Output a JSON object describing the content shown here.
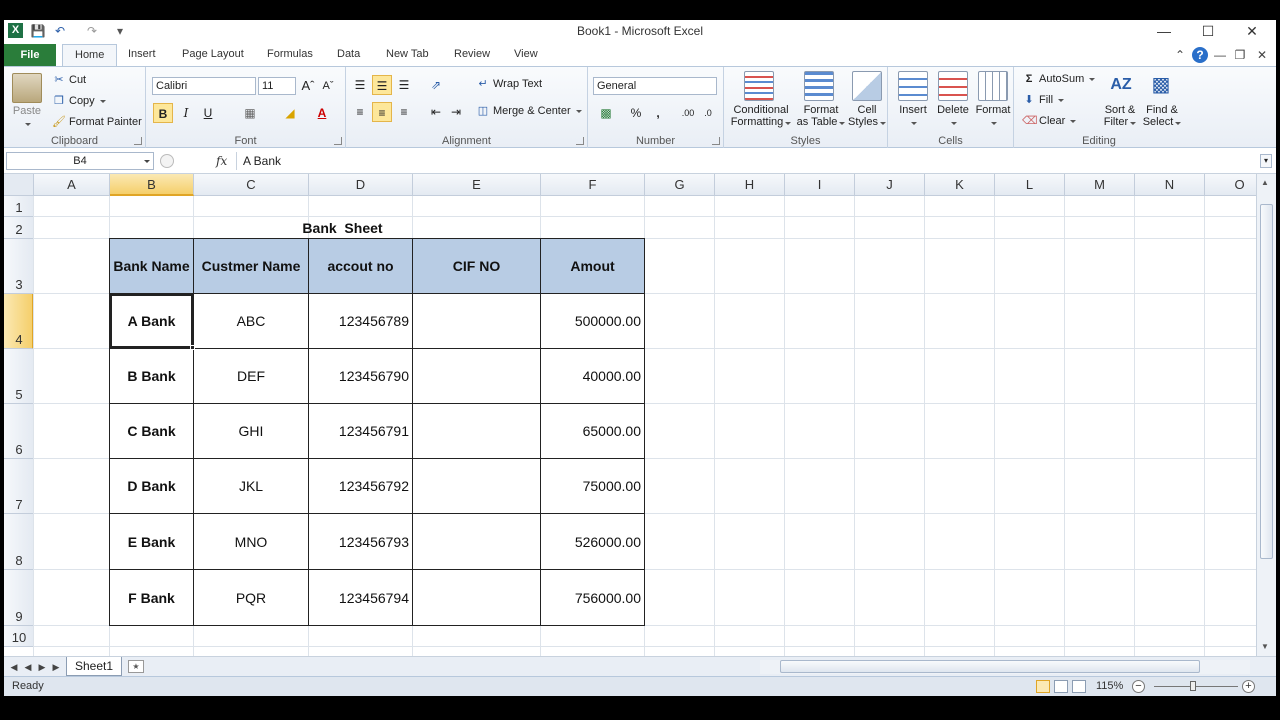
{
  "window": {
    "title": "Book1 - Microsoft Excel"
  },
  "tabs": {
    "file": "File",
    "items": [
      "Home",
      "Insert",
      "Page Layout",
      "Formulas",
      "Data",
      "New Tab",
      "Review",
      "View"
    ],
    "active": "Home"
  },
  "ribbon": {
    "clipboard": {
      "label": "Clipboard",
      "paste": "Paste",
      "cut": "Cut",
      "copy": "Copy",
      "format_painter": "Format Painter"
    },
    "font": {
      "label": "Font",
      "name": "Calibri",
      "size": "11",
      "bold": "B",
      "italic": "I",
      "underline": "U",
      "font_color_glyph": "A"
    },
    "alignment": {
      "label": "Alignment",
      "wrap": "Wrap Text",
      "merge": "Merge & Center"
    },
    "number": {
      "label": "Number",
      "format": "General",
      "percent": "%",
      "comma": ","
    },
    "styles": {
      "label": "Styles",
      "conditional": "Conditional",
      "conditional2": "Formatting",
      "format_table": "Format",
      "format_table2": "as Table",
      "cell_styles": "Cell",
      "cell_styles2": "Styles"
    },
    "cells": {
      "label": "Cells",
      "insert": "Insert",
      "delete": "Delete",
      "format": "Format"
    },
    "editing": {
      "label": "Editing",
      "autosum": "AutoSum",
      "fill": "Fill",
      "clear": "Clear",
      "sort": "Sort &",
      "sort2": "Filter",
      "find": "Find &",
      "find2": "Select"
    }
  },
  "formula_bar": {
    "name_box": "B4",
    "fx": "fx",
    "content": "A Bank"
  },
  "grid": {
    "columns": [
      "A",
      "B",
      "C",
      "D",
      "E",
      "F",
      "G",
      "H",
      "I",
      "J",
      "K",
      "L",
      "M",
      "N",
      "O"
    ],
    "rows": [
      "1",
      "2",
      "3",
      "4",
      "5",
      "6",
      "7",
      "8",
      "9",
      "10"
    ],
    "selected_column": "B",
    "selected_row": "4"
  },
  "sheet": {
    "title": "Bank  Sheet",
    "headers": [
      "Bank Name",
      "Custmer Name",
      "accout no",
      "CIF NO",
      "Amout"
    ],
    "rows": [
      [
        "A Bank",
        "ABC",
        "123456789",
        "",
        "500000.00"
      ],
      [
        "B Bank",
        "DEF",
        "123456790",
        "",
        "40000.00"
      ],
      [
        "C Bank",
        "GHI",
        "123456791",
        "",
        "65000.00"
      ],
      [
        "D Bank",
        "JKL",
        "123456792",
        "",
        "75000.00"
      ],
      [
        "E Bank",
        "MNO",
        "123456793",
        "",
        "526000.00"
      ],
      [
        "F Bank",
        "PQR",
        "123456794",
        "",
        "756000.00"
      ]
    ]
  },
  "sheet_tabs": {
    "active": "Sheet1"
  },
  "status": {
    "ready": "Ready",
    "zoom": "115%"
  },
  "colors": {
    "header_fill": "#b8cce4",
    "file_tab": "#2a7d3a",
    "selection": "#f5cf6b"
  }
}
